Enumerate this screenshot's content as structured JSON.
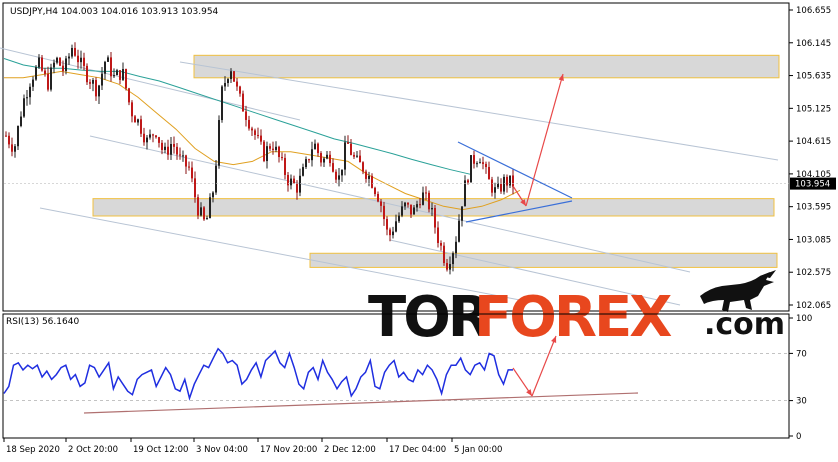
{
  "chart_data": [
    {
      "type": "line",
      "name": "price",
      "title": "USDJPY,H4  104.003 104.016 103.913 103.954",
      "ylim": [
        102.065,
        106.655
      ],
      "yticks": [
        "106.655",
        "106.145",
        "105.635",
        "105.125",
        "104.615",
        "104.105",
        "103.595",
        "103.085",
        "102.575",
        "102.065"
      ],
      "ytick_values": [
        106.655,
        106.145,
        105.635,
        105.125,
        104.615,
        104.105,
        103.595,
        103.085,
        102.575,
        102.065
      ],
      "last_price": "103.954",
      "last_price_value": 103.954,
      "series": [
        {
          "values": [
            104.7,
            104.5,
            105.2,
            105.6,
            105.8,
            105.5,
            105.9,
            105.7,
            106.1,
            105.8,
            105.6,
            105.4,
            105.9,
            105.6,
            105.7,
            105.1,
            104.9,
            104.6,
            104.8,
            104.4,
            104.6,
            104.3,
            104.2,
            103.6,
            103.3,
            103.9,
            105.4,
            105.8,
            105.3,
            105.0,
            104.7,
            104.4,
            104.6,
            104.3,
            104.0,
            103.9,
            104.2,
            104.6,
            104.3,
            104.4,
            104.0,
            104.6,
            104.3,
            104.2,
            104.0,
            103.7,
            103.1,
            103.4,
            103.6,
            103.5,
            103.8,
            103.6,
            103.1,
            102.7,
            103.0,
            103.8,
            104.3,
            104.4,
            104.0,
            103.8,
            104.0,
            103.95
          ]
        },
        {
          "values": [
            105.9,
            105.8,
            105.75,
            105.75,
            105.72,
            105.7,
            105.7,
            105.62,
            105.55,
            105.45,
            105.35,
            105.25,
            105.15,
            105.05,
            104.95,
            104.85,
            104.75,
            104.65,
            104.58,
            104.5,
            104.42,
            104.33,
            104.25,
            104.17,
            104.1
          ]
        },
        {
          "values": [
            105.6,
            105.6,
            105.65,
            105.7,
            105.65,
            105.6,
            105.5,
            105.3,
            105.05,
            104.8,
            104.5,
            104.3,
            104.25,
            104.3,
            104.45,
            104.45,
            104.4,
            104.35,
            104.3,
            104.1,
            103.95,
            103.8,
            103.7,
            103.6,
            103.55,
            103.6,
            103.7,
            103.85
          ]
        }
      ],
      "zones": [
        {
          "low": 105.6,
          "high": 105.95
        },
        {
          "low": 103.45,
          "high": 103.72
        },
        {
          "low": 102.65,
          "high": 102.87
        }
      ],
      "zone_color": "#f0c040",
      "channel_color": "#b8c4d4",
      "wedge_color": "#3a6fd8",
      "arrow_color": "#e84848",
      "logo": {
        "part1": "TOR",
        "part2": "FOREX",
        "part3": ".com",
        "color1": "#111111",
        "color2": "#e8471e"
      }
    },
    {
      "type": "line",
      "name": "rsi",
      "title": "RSI(13) 56.1640",
      "ylim": [
        0,
        100
      ],
      "yticks": [
        "100",
        "70",
        "30",
        "0"
      ],
      "ytick_values": [
        100,
        70,
        30,
        0
      ],
      "levels": [
        70,
        30
      ],
      "values": [
        36,
        42,
        60,
        62,
        56,
        60,
        57,
        60,
        50,
        55,
        48,
        52,
        58,
        60,
        48,
        52,
        42,
        45,
        60,
        58,
        50,
        56,
        62,
        40,
        50,
        44,
        38,
        35,
        48,
        52,
        54,
        56,
        42,
        50,
        58,
        52,
        40,
        38,
        48,
        32,
        44,
        52,
        60,
        58,
        66,
        74,
        70,
        62,
        64,
        60,
        44,
        48,
        56,
        62,
        50,
        64,
        68,
        72,
        62,
        58,
        70,
        58,
        44,
        40,
        54,
        58,
        48,
        64,
        54,
        48,
        40,
        46,
        50,
        34,
        40,
        50,
        54,
        64,
        42,
        40,
        54,
        60,
        64,
        50,
        54,
        48,
        46,
        56,
        52,
        60,
        56,
        48,
        36,
        52,
        60,
        60,
        66,
        56,
        52,
        60,
        62,
        56,
        70,
        68,
        52,
        44,
        56,
        56
      ],
      "color": "#1f2ee0",
      "trend_color": "#b07070",
      "arrow_color": "#e84848"
    },
    {
      "type": "line",
      "name": "time_axis",
      "x_labels": [
        "18 Sep 2020",
        "2 Oct 20:00",
        "19 Oct 12:00",
        "3 Nov 04:00",
        "17 Nov 20:00",
        "2 Dec 12:00",
        "17 Dec 04:00",
        "5 Jan 00:00"
      ]
    }
  ]
}
